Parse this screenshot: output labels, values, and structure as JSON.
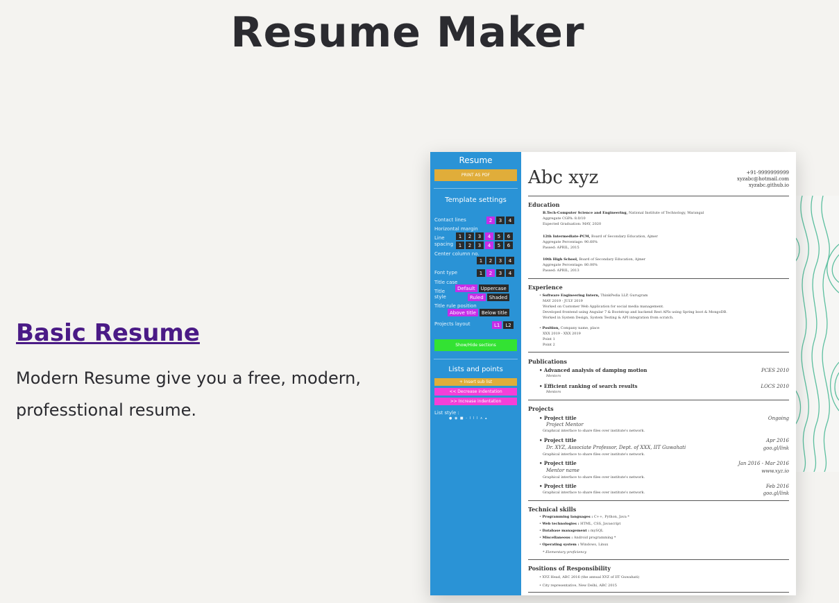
{
  "page": {
    "title": "Resume Maker",
    "heading_link": "Basic Resume",
    "description_line1": "Modern Resume give you a free, modern,",
    "description_line2": "professtional resume."
  },
  "sidebar": {
    "title": "Resume",
    "print_button": "PRINT AS PDF",
    "template_settings": "Template settings",
    "contact_lines": {
      "label": "Contact lines",
      "options": [
        "2",
        "3",
        "4"
      ],
      "selected": "2"
    },
    "horizontal_margin": {
      "label": "Horizontal margin",
      "options": [
        "1",
        "2",
        "3",
        "4",
        "5",
        "6"
      ],
      "selected": "4"
    },
    "line_spacing": {
      "label_a": "Line",
      "label_b": "spacing",
      "options": [
        "1",
        "2",
        "3",
        "4",
        "5",
        "6"
      ],
      "selected": "4"
    },
    "center_column": {
      "label": "Center column no.",
      "options": [
        "1",
        "2",
        "3",
        "4"
      ]
    },
    "font_type": {
      "label": "Font type",
      "options": [
        "1",
        "2",
        "3",
        "4"
      ],
      "selected": "2"
    },
    "title_case": {
      "label": "Title case",
      "options": [
        "Default",
        "Uppercase"
      ],
      "selected": "Default"
    },
    "title_style": {
      "label_a": "Title",
      "label_b": "style",
      "options": [
        "Ruled",
        "Shaded"
      ],
      "selected": "Ruled"
    },
    "title_rule_position": {
      "label": "Title rule position",
      "options": [
        "Above title",
        "Below title"
      ],
      "selected": "Above title"
    },
    "projects_layout": {
      "label": "Projects layout",
      "options": [
        "L1",
        "L2"
      ],
      "selected": "L1"
    },
    "show_hide": "Show/Hide sections",
    "lists_title": "Lists and points",
    "insert_sub_list": "+ Insert sub list",
    "decrease_indent": "<< Decrease indentation",
    "increase_indent": ">> Increase indentation",
    "list_style": "List style :",
    "list_style_glyphs": "● ◉ ■ - I I I ∧ ▴",
    "colors": {
      "sidebar": "#2a93d6",
      "selected": "#c52ee8",
      "print": "#e0ad3a",
      "show_hide": "#33e233",
      "indent": "#f43fd8"
    }
  },
  "resume": {
    "name": "Abc xyz",
    "phone": "+91-9999999999",
    "email": "xyzabc@hotmail.com",
    "website": "xyzabc.github.io",
    "education": {
      "title": "Education",
      "e1_deg": "B.Tech-Computer Science and Engineering,",
      "e1_inst": " National Institute of Technology, Warangal",
      "e1_l2": "Aggregate CGPA: 8.0/10",
      "e1_l3": "Expected Graduation: MAY, 2020",
      "e2_deg": "12th Intermediate-PCM,",
      "e2_inst": " Board of Secondary Education, Ajmer",
      "e2_l2": "Aggregate Percentage: 90.60%",
      "e2_l3": "Passed: APRIL, 2015",
      "e3_deg": "10th High School,",
      "e3_inst": " Board of Secondary Education, Ajmer",
      "e3_l2": "Aggregate Percentage: 80.00%",
      "e3_l3": "Passed: APRIL, 2013"
    },
    "experience": {
      "title": "Experience",
      "x1_role": "Software Engineering Intern,",
      "x1_org": " ThinkPedia LLP, Gurugram",
      "x1_date": "MAY 2019 - JULY 2019",
      "x1_p1": "Worked on Customer Web Application for social media management.",
      "x1_p2": "Developed frontend using Angular 7 & Bootstrap and backend Rest APIs using Spring boot & MongoDB.",
      "x1_p3": "Worked in System Design, System Testing & API integration from scratch.",
      "x2_role": "Position,",
      "x2_org": " Company name, place",
      "x2_date": "XXX 2019 - XXX 2019",
      "x2_p1": "Point 1",
      "x2_p2": "Point 2"
    },
    "publications": {
      "title": "Publications",
      "p1": "Advanced analysis of damping motion",
      "p1_sub": "Mentors",
      "p1_venue": "PCES 2010",
      "p2": "Efficient ranking of search results",
      "p2_sub": "Mentors",
      "p2_venue": "LOCS 2010"
    },
    "projects": {
      "title": "Projects",
      "items": [
        {
          "name": "Project title",
          "sub": "Project Mentor",
          "desc": "Graphical interface to share files over institute's network.",
          "date": "Ongoing",
          "link": ""
        },
        {
          "name": "Project title",
          "sub": "Dr. XYZ, Associate Professor, Dept. of XXX, IIT Guwahati",
          "desc": "Graphical interface to share files over institute's network.",
          "date": "Apr 2016",
          "link": "goo.gl/link"
        },
        {
          "name": "Project title",
          "sub": "Mentor name",
          "desc": "Graphical interface to share files over institute's network.",
          "date": "Jan 2016 - Mar 2016",
          "link": "www.xyz.io"
        },
        {
          "name": "Project title",
          "sub": "",
          "desc": "Graphical interface to share files over institute's network.",
          "date": "Feb 2016",
          "link": "goo.gl/link"
        }
      ]
    },
    "skills": {
      "title": "Technical skills",
      "s1_k": "Programming languages :",
      "s1_v": " C++, Python, Java *",
      "s2_k": "Web technologies :",
      "s2_v": " HTML, CSS, Javascript",
      "s3_k": "Database management :",
      "s3_v": " mySQL",
      "s4_k": "Miscellaneous :",
      "s4_v": " Android programming *",
      "s5_k": "Operating system :",
      "s5_v": " Windows, Linux",
      "note": "* Elementary proficiency"
    },
    "por": {
      "title": "Positions of Responsibility",
      "r1": "XYZ Head, ABC 2016 (the annual XYZ of IIT Guwahati)",
      "r2": "City representative, New Delhi, ABC 2015"
    }
  }
}
